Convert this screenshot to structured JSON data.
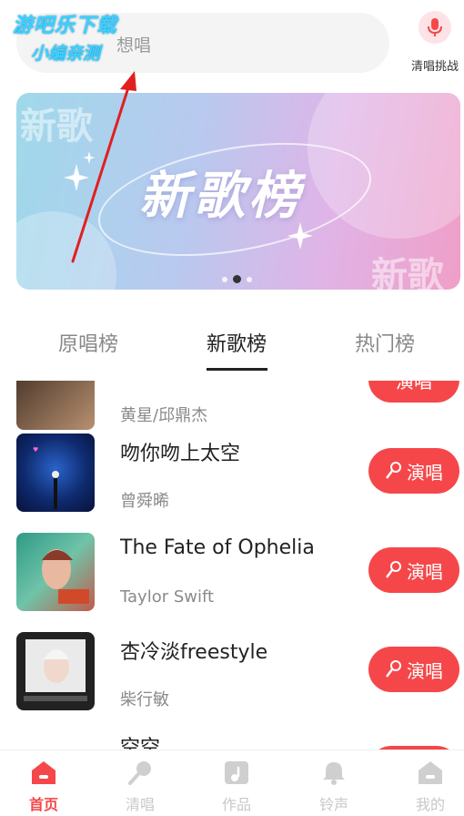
{
  "header": {
    "search_placeholder": "想唱",
    "watermark_line1": "游吧乐下载",
    "watermark_line2": "小编亲测",
    "challenge_label": "清唱挑战",
    "challenge_icon": "microphone-icon"
  },
  "banner": {
    "title": "新歌榜",
    "bg_word": "新歌",
    "slide_count": 3,
    "active_slide": 2
  },
  "tabs": [
    {
      "label": "原唱榜",
      "active": false
    },
    {
      "label": "新歌榜",
      "active": true
    },
    {
      "label": "热门榜",
      "active": false
    }
  ],
  "songs": [
    {
      "title": "",
      "artist": "黄星/邱鼎杰",
      "button": "演唱"
    },
    {
      "title": "吻你吻上太空",
      "artist": "曾舜晞",
      "button": "演唱"
    },
    {
      "title": "The Fate of Ophelia",
      "artist": "Taylor Swift",
      "button": "演唱"
    },
    {
      "title": "杏冷淡freestyle",
      "artist": "柴行敏",
      "button": "演唱"
    },
    {
      "title": "空空",
      "artist": "",
      "button": "演唱"
    }
  ],
  "bottom_nav": [
    {
      "label": "首页",
      "icon": "home-icon",
      "active": true
    },
    {
      "label": "清唱",
      "icon": "microphone-icon",
      "active": false
    },
    {
      "label": "作品",
      "icon": "music-note-icon",
      "active": false
    },
    {
      "label": "铃声",
      "icon": "bell-icon",
      "active": false
    },
    {
      "label": "我的",
      "icon": "profile-home-icon",
      "active": false
    }
  ],
  "colors": {
    "accent": "#f5474a",
    "text_primary": "#222222",
    "text_secondary": "#8a8a8a",
    "inactive_icon": "#cfcfcf",
    "annotation_arrow": "#e0201f"
  }
}
